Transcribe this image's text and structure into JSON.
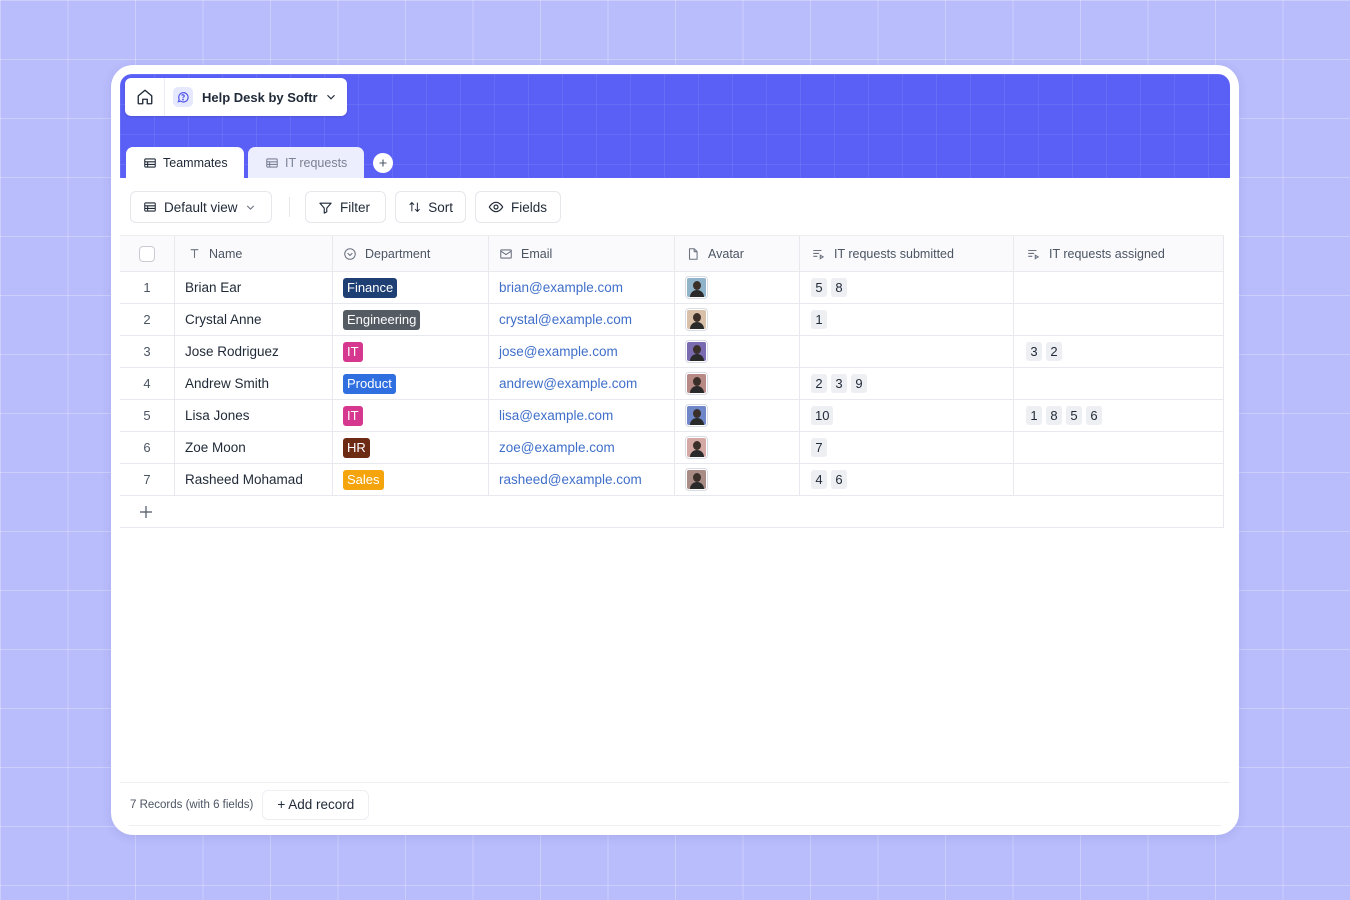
{
  "app": {
    "name": "Help Desk by Softr",
    "accent_color": "#5a5ff5",
    "icons": {
      "home": "home-icon",
      "app": "help-circle-icon",
      "chevron": "chevron-down-icon"
    }
  },
  "tabs": [
    {
      "label": "Teammates",
      "active": true,
      "icon": "table-icon"
    },
    {
      "label": "IT requests",
      "active": false,
      "icon": "table-icon"
    }
  ],
  "toolbar": {
    "view_label": "Default view",
    "filter_label": "Filter",
    "sort_label": "Sort",
    "fields_label": "Fields"
  },
  "columns": [
    {
      "label": "Name",
      "icon": "text-type-icon"
    },
    {
      "label": "Department",
      "icon": "single-select-icon"
    },
    {
      "label": "Email",
      "icon": "mail-icon"
    },
    {
      "label": "Avatar",
      "icon": "file-icon"
    },
    {
      "label": "IT requests submitted",
      "icon": "linked-record-icon"
    },
    {
      "label": "IT requests assigned",
      "icon": "linked-record-icon"
    }
  ],
  "rows": [
    {
      "num": "1",
      "name": "Brian Ear",
      "department": {
        "label": "Finance",
        "color": "#1e3f73"
      },
      "email": "brian@example.com",
      "avatar_color": "#8fb3c9",
      "submitted": [
        "5",
        "8"
      ],
      "assigned": []
    },
    {
      "num": "2",
      "name": "Crystal Anne",
      "department": {
        "label": "Engineering",
        "color": "#555b63"
      },
      "email": "crystal@example.com",
      "avatar_color": "#d7bfa8",
      "submitted": [
        "1"
      ],
      "assigned": []
    },
    {
      "num": "3",
      "name": "Jose Rodriguez",
      "department": {
        "label": "IT",
        "color": "#d6378f"
      },
      "email": "jose@example.com",
      "avatar_color": "#7a6bb0",
      "submitted": [],
      "assigned": [
        "3",
        "2"
      ]
    },
    {
      "num": "4",
      "name": "Andrew Smith",
      "department": {
        "label": "Product",
        "color": "#2f6fe0"
      },
      "email": "andrew@example.com",
      "avatar_color": "#b88a86",
      "submitted": [
        "2",
        "3",
        "9"
      ],
      "assigned": []
    },
    {
      "num": "5",
      "name": "Lisa Jones",
      "department": {
        "label": "IT",
        "color": "#d6378f"
      },
      "email": "lisa@example.com",
      "avatar_color": "#6f86c9",
      "submitted": [
        "10"
      ],
      "assigned": [
        "1",
        "8",
        "5",
        "6"
      ]
    },
    {
      "num": "6",
      "name": "Zoe Moon",
      "department": {
        "label": "HR",
        "color": "#6e2b14"
      },
      "email": "zoe@example.com",
      "avatar_color": "#d5a9a3",
      "submitted": [
        "7"
      ],
      "assigned": []
    },
    {
      "num": "7",
      "name": "Rasheed Mohamad",
      "department": {
        "label": "Sales",
        "color": "#f5a40c"
      },
      "email": "rasheed@example.com",
      "avatar_color": "#a98c86",
      "submitted": [
        "4",
        "6"
      ],
      "assigned": []
    }
  ],
  "footer": {
    "count_label": "7 Records (with 6 fields)",
    "add_label": "+ Add record"
  }
}
